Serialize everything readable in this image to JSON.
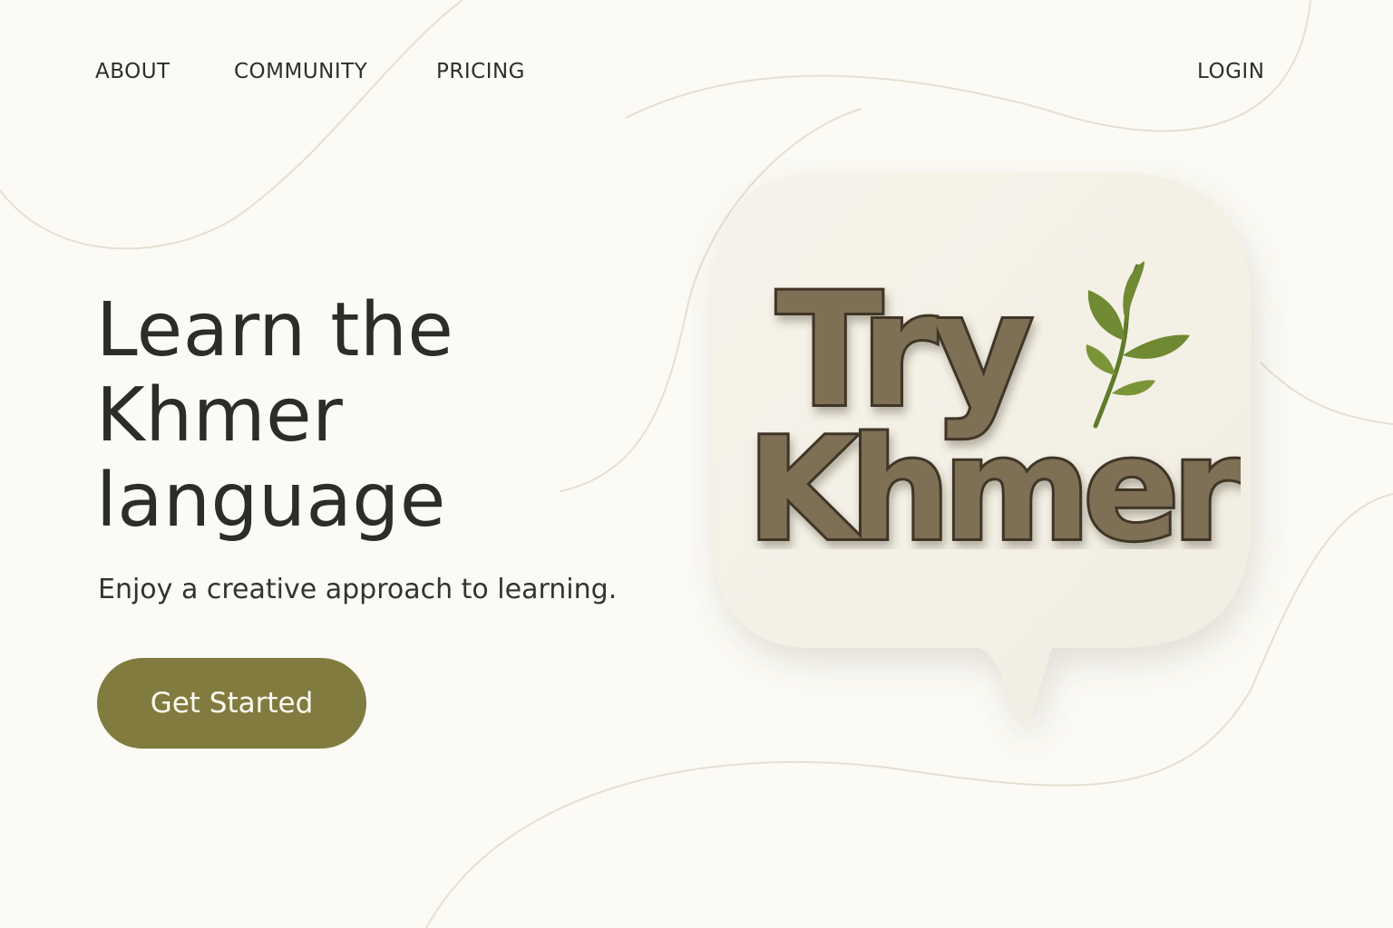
{
  "nav": {
    "about": "ABOUT",
    "community": "COMMUNITY",
    "pricing": "PRICING",
    "login": "LOGIN"
  },
  "hero": {
    "title_lines": [
      "Learn the",
      "Khmer",
      "language"
    ],
    "subtitle": "Enjoy a creative approach to learning.",
    "cta_label": "Get Started"
  },
  "logo": {
    "line1": "Try",
    "line2": "Khmer"
  },
  "colors": {
    "background": "#fbfaf5",
    "text": "#2e2e2a",
    "accent": "#827b3f",
    "stone": "#7d6f55",
    "leaf": "#6f8a32"
  },
  "icons": {
    "plant": "sprout-icon",
    "bubble": "speech-bubble"
  }
}
